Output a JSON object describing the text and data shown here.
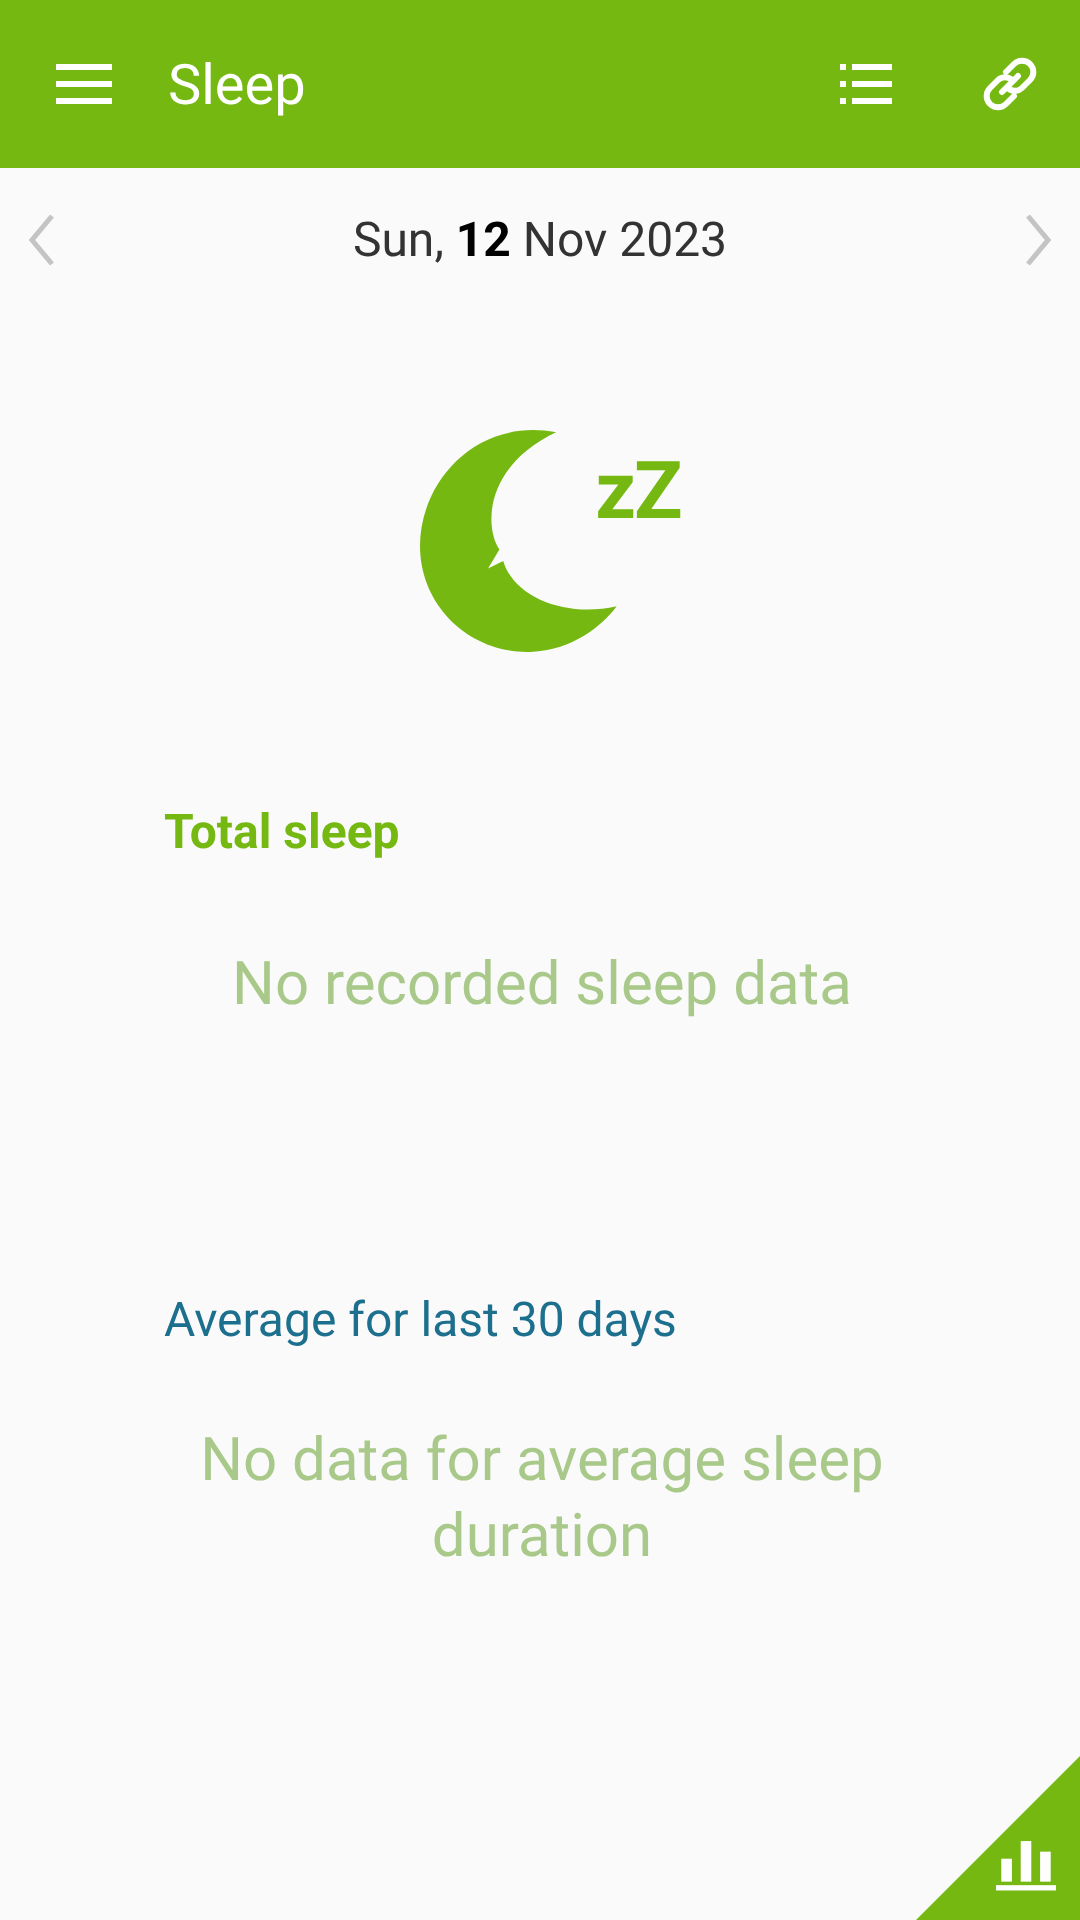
{
  "app_bar": {
    "title": "Sleep"
  },
  "date_nav": {
    "date": "Sun, **12** Nov 2023"
  },
  "logo": {
    "letters": "zZ"
  },
  "sections": [
    {
      "kind": "total",
      "heading": "Total sleep",
      "message": "No recorded sleep data"
    },
    {
      "kind": "average",
      "heading": "Average for last 30 days",
      "message": "No data for average sleep duration"
    }
  ]
}
